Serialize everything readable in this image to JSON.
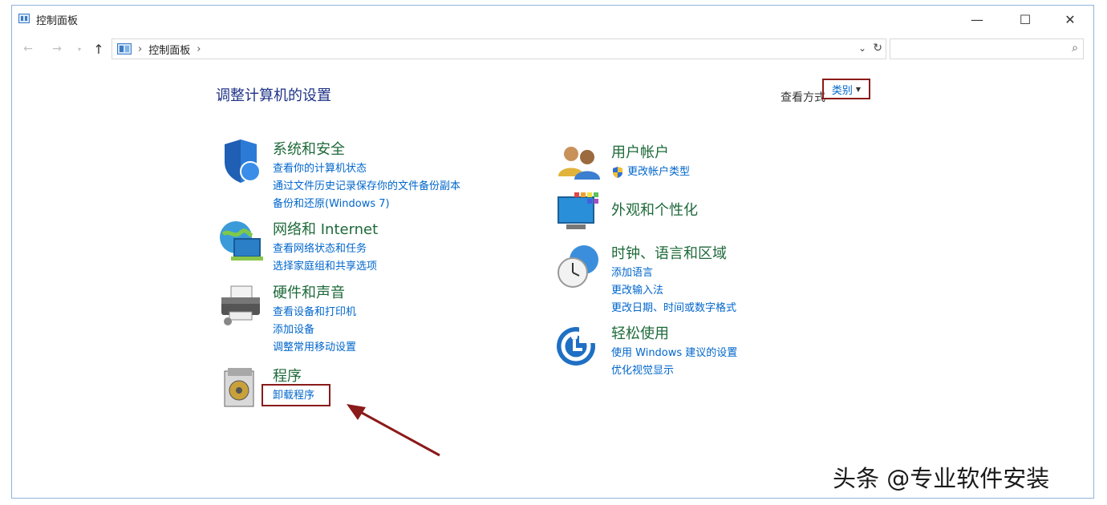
{
  "window": {
    "title": "控制面板",
    "controls": {
      "minimize": "—",
      "maximize": "☐",
      "close": "✕"
    }
  },
  "navbar": {
    "back": "←",
    "forward": "→",
    "up": "↑",
    "separator": "›",
    "breadcrumb": "控制面板",
    "dropdown": "⌄",
    "refresh": "↻",
    "search_placeholder": "",
    "search_icon": "⌕"
  },
  "main": {
    "heading": "调整计算机的设置",
    "view_by_label": "查看方式",
    "view_by_value": "类别",
    "categories_left": [
      {
        "title": "系统和安全",
        "icon": "shield-icon",
        "links": [
          "查看你的计算机状态",
          "通过文件历史记录保存你的文件备份副本",
          "备份和还原(Windows 7)"
        ]
      },
      {
        "title": "网络和 Internet",
        "icon": "globe-network-icon",
        "links": [
          "查看网络状态和任务",
          "选择家庭组和共享选项"
        ]
      },
      {
        "title": "硬件和声音",
        "icon": "printer-icon",
        "links": [
          "查看设备和打印机",
          "添加设备",
          "调整常用移动设置"
        ]
      },
      {
        "title": "程序",
        "icon": "programs-icon",
        "links": [
          "卸载程序"
        ]
      }
    ],
    "categories_right": [
      {
        "title": "用户帐户",
        "icon": "users-icon",
        "links": [
          "更改帐户类型"
        ]
      },
      {
        "title": "外观和个性化",
        "icon": "monitor-icon",
        "links": []
      },
      {
        "title": "时钟、语言和区域",
        "icon": "clock-globe-icon",
        "links": [
          "添加语言",
          "更改输入法",
          "更改日期、时间或数字格式"
        ]
      },
      {
        "title": "轻松使用",
        "icon": "ease-of-access-icon",
        "links": [
          "使用 Windows 建议的设置",
          "优化视觉显示"
        ]
      }
    ]
  },
  "colors": {
    "accent_red": "#8b1a1a",
    "link_blue": "#0066cc",
    "category_green": "#1e6a3a"
  },
  "watermark": "头条 @专业软件安装"
}
